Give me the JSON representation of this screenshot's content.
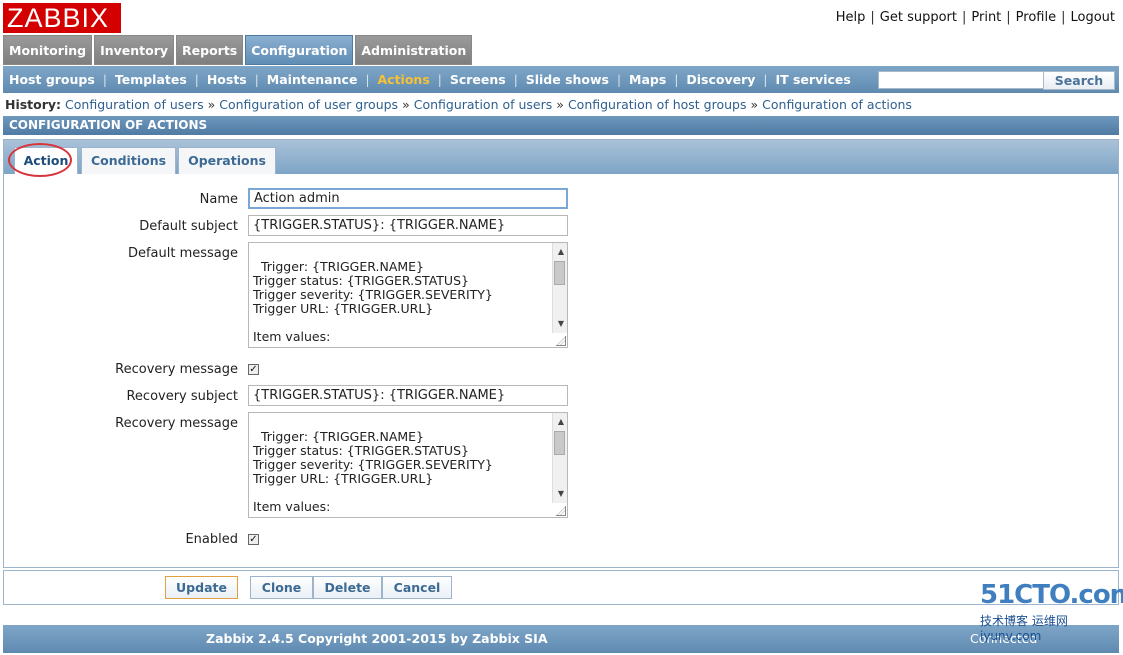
{
  "brand": {
    "logo": "ZABBIX"
  },
  "top_links": [
    "Help",
    "Get support",
    "Print",
    "Profile",
    "Logout"
  ],
  "main_menu": [
    "Monitoring",
    "Inventory",
    "Reports",
    "Configuration",
    "Administration"
  ],
  "sub_menu": [
    "Host groups",
    "Templates",
    "Hosts",
    "Maintenance",
    "Actions",
    "Screens",
    "Slide shows",
    "Maps",
    "Discovery",
    "IT services"
  ],
  "search": {
    "button": "Search",
    "value": ""
  },
  "history": {
    "label": "History:",
    "items": [
      "Configuration of users",
      "Configuration of user groups",
      "Configuration of users",
      "Configuration of host groups",
      "Configuration of actions"
    ]
  },
  "section_title": "CONFIGURATION OF ACTIONS",
  "tabs": [
    "Action",
    "Conditions",
    "Operations"
  ],
  "form": {
    "name_label": "Name",
    "name_value": "Action admin",
    "default_subject_label": "Default subject",
    "default_subject_value": "{TRIGGER.STATUS}: {TRIGGER.NAME}",
    "default_message_label": "Default message",
    "default_message_value": "Trigger: {TRIGGER.NAME}\nTrigger status: {TRIGGER.STATUS}\nTrigger severity: {TRIGGER.SEVERITY}\nTrigger URL: {TRIGGER.URL}\n\nItem values:\n",
    "recovery_message_checkbox_label": "Recovery message",
    "recovery_subject_label": "Recovery subject",
    "recovery_subject_value": "{TRIGGER.STATUS}: {TRIGGER.NAME}",
    "recovery_message_label": "Recovery message",
    "recovery_message_value": "Trigger: {TRIGGER.NAME}\nTrigger status: {TRIGGER.STATUS}\nTrigger severity: {TRIGGER.SEVERITY}\nTrigger URL: {TRIGGER.URL}\n\nItem values:\n",
    "enabled_label": "Enabled"
  },
  "buttons": [
    "Update",
    "Clone",
    "Delete",
    "Cancel"
  ],
  "footer": {
    "copyright": "Zabbix 2.4.5 Copyright 2001-2015 by Zabbix SIA",
    "connected": "Connected"
  },
  "watermark": {
    "top": "51CTO.com",
    "bottom": "技术博客 运维网 iyunv.com"
  }
}
